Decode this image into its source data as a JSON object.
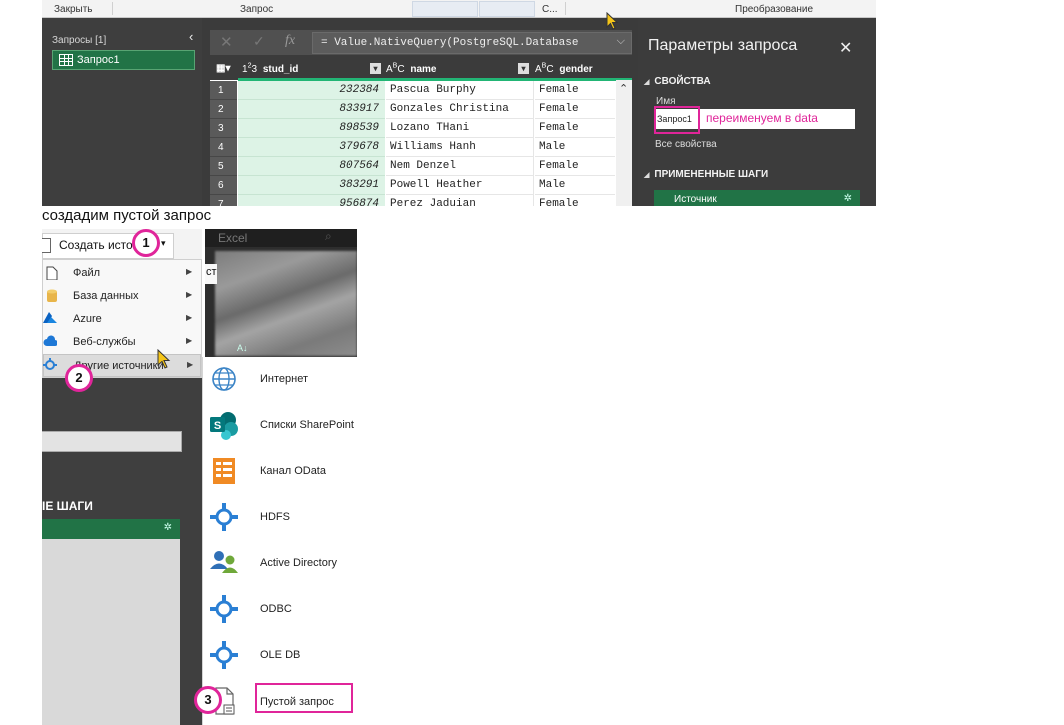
{
  "ribbon": {
    "close": "Закрыть",
    "query": "Запрос",
    "c": "С...",
    "transform": "Преобразование"
  },
  "queries_pane": {
    "header": "Запросы [1]",
    "item": "Запрос1"
  },
  "formula": {
    "text": "= Value.NativeQuery(PostgreSQL.Database",
    "fx": "fx"
  },
  "grid": {
    "columns": [
      {
        "type": "123",
        "name": "stud_id"
      },
      {
        "type": "ABC",
        "name": "name"
      },
      {
        "type": "ABC",
        "name": "gender"
      }
    ],
    "rows": [
      {
        "n": "1",
        "id": "232384",
        "name": "Pascua Burphy",
        "gender": "Female"
      },
      {
        "n": "2",
        "id": "833917",
        "name": "Gonzales Christina",
        "gender": "Female"
      },
      {
        "n": "3",
        "id": "898539",
        "name": "Lozano THani",
        "gender": "Female"
      },
      {
        "n": "4",
        "id": "379678",
        "name": "Williams Hanh",
        "gender": "Male"
      },
      {
        "n": "5",
        "id": "807564",
        "name": "Nem Denzel",
        "gender": "Female"
      },
      {
        "n": "6",
        "id": "383291",
        "name": "Powell Heather",
        "gender": "Male"
      },
      {
        "n": "7",
        "id": "956874",
        "name": "Perez Jaduian",
        "gender": "Female"
      }
    ]
  },
  "params": {
    "title": "Параметры запроса",
    "properties": "СВОЙСТВА",
    "name_label": "Имя",
    "name_value": "Запрос1",
    "rename_note": "переименуем в data",
    "all_props": "Все свойства",
    "applied_steps": "ПРИМЕНЕННЫЕ ШАГИ",
    "step1": "Источник"
  },
  "caption": "создадим пустой запрос",
  "create_button": "Создать источ...",
  "menu": [
    {
      "label": "Файл",
      "icon": "file-icon"
    },
    {
      "label": "База данных",
      "icon": "database-icon"
    },
    {
      "label": "Azure",
      "icon": "azure-icon"
    },
    {
      "label": "Веб-службы",
      "icon": "cloud-icon"
    },
    {
      "label": "Другие источники",
      "icon": "other-sources-icon"
    }
  ],
  "background_app": {
    "title": "Excel",
    "st": "ст",
    "av": "A↓",
    "steps": "ІЕ ШАГИ"
  },
  "submenu": [
    {
      "label": "Интернет",
      "icon": "globe-icon"
    },
    {
      "label": "Списки SharePoint",
      "icon": "sharepoint-icon"
    },
    {
      "label": "Канал OData",
      "icon": "odata-icon"
    },
    {
      "label": "HDFS",
      "icon": "hdfs-icon"
    },
    {
      "label": "Active Directory",
      "icon": "active-directory-icon"
    },
    {
      "label": "ODBC",
      "icon": "odbc-icon"
    },
    {
      "label": "OLE DB",
      "icon": "oledb-icon"
    },
    {
      "label": "Пустой запрос",
      "icon": "blank-query-icon"
    }
  ],
  "badges": [
    "1",
    "2",
    "3"
  ],
  "colors": {
    "accent_green": "#217346",
    "highlight_pink": "#e0259a",
    "dark_panel": "#3c3c3c"
  }
}
